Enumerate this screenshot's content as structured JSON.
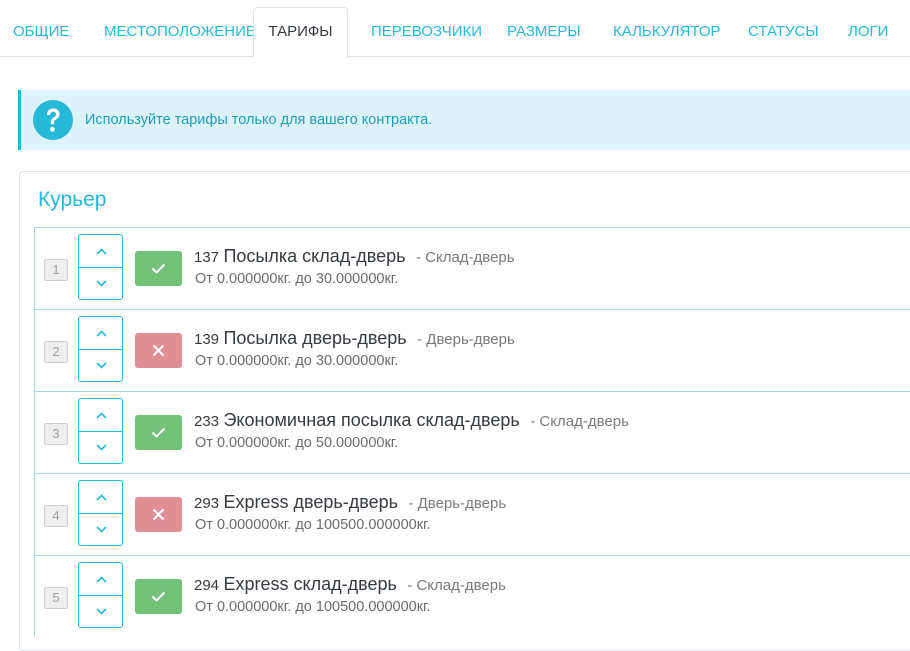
{
  "tabs": [
    {
      "label": "ОБЩИЕ",
      "active": false
    },
    {
      "label": "МЕСТОПОЛОЖЕНИЕ",
      "active": false
    },
    {
      "label": "ТАРИФЫ",
      "active": true
    },
    {
      "label": "ПЕРЕВОЗЧИКИ",
      "active": false
    },
    {
      "label": "РАЗМЕРЫ",
      "active": false
    },
    {
      "label": "КАЛЬКУЛЯТОР",
      "active": false
    },
    {
      "label": "СТАТУСЫ",
      "active": false
    },
    {
      "label": "ЛОГИ",
      "active": false
    }
  ],
  "alert": {
    "icon": "question-circle-icon",
    "text": "Используйте тарифы только для вашего контракта."
  },
  "panel": {
    "title": "Курьер",
    "tariffs": [
      {
        "position": "1",
        "enabled": true,
        "code": "137",
        "name": "Посылка склад-дверь",
        "type": "- Склад-дверь",
        "weight": "От 0.000000кг. до 30.000000кг."
      },
      {
        "position": "2",
        "enabled": false,
        "code": "139",
        "name": "Посылка дверь-дверь",
        "type": "- Дверь-дверь",
        "weight": "От 0.000000кг. до 30.000000кг."
      },
      {
        "position": "3",
        "enabled": true,
        "code": "233",
        "name": "Экономичная посылка склад-дверь",
        "type": "- Склад-дверь",
        "weight": "От 0.000000кг. до 50.000000кг."
      },
      {
        "position": "4",
        "enabled": false,
        "code": "293",
        "name": "Express дверь-дверь",
        "type": "- Дверь-дверь",
        "weight": "От 0.000000кг. до 100500.000000кг."
      },
      {
        "position": "5",
        "enabled": true,
        "code": "294",
        "name": "Express склад-дверь",
        "type": "- Склад-дверь",
        "weight": "От 0.000000кг. до 100500.000000кг."
      }
    ]
  },
  "colors": {
    "accent": "#25b9d7",
    "enabled": "#72c279",
    "disabled": "#e08f95",
    "alert_bg": "#dcf4f9"
  }
}
